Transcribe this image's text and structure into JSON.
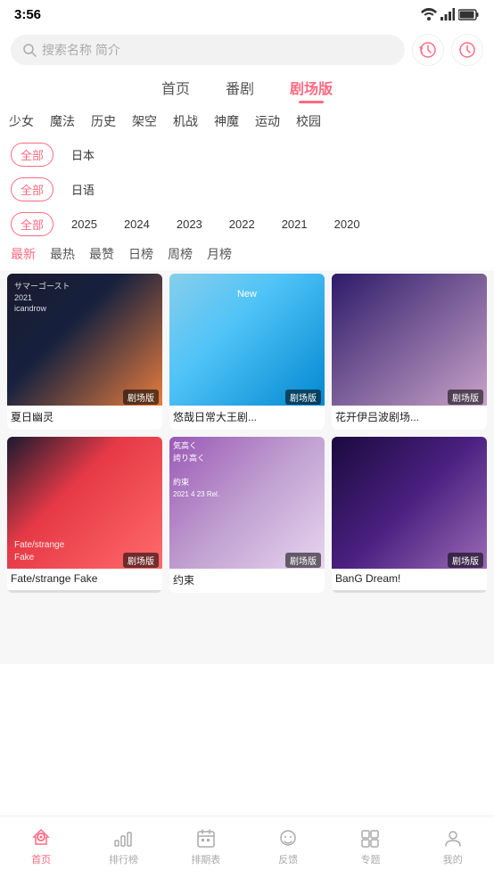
{
  "status": {
    "time": "3:56",
    "battery_icon": "🔋",
    "signal_icon": "📶"
  },
  "search": {
    "placeholder": "搜索名称 简介",
    "history_icon": "history",
    "clock_icon": "clock"
  },
  "nav": {
    "tabs": [
      {
        "id": "home",
        "label": "首页",
        "active": false
      },
      {
        "id": "series",
        "label": "番剧",
        "active": false
      },
      {
        "id": "theater",
        "label": "剧场版",
        "active": true
      }
    ]
  },
  "genres": [
    "女",
    "魔法",
    "历史",
    "架空",
    "机战",
    "神魔",
    "运动",
    "校"
  ],
  "filters": {
    "region": {
      "options": [
        "全部",
        "日本"
      ],
      "active": "全部"
    },
    "language": {
      "options": [
        "全部",
        "日语"
      ],
      "active": "全部"
    },
    "year": {
      "options": [
        "全部",
        "2025",
        "2024",
        "2023",
        "2022",
        "2021",
        "2020"
      ],
      "active": "全部"
    }
  },
  "sort": {
    "options": [
      "最新",
      "最热",
      "最赞",
      "日榜",
      "周榜",
      "月榜"
    ],
    "active": "最新"
  },
  "anime_list": [
    {
      "id": 1,
      "title": "夏日幽灵",
      "badge": "剧场版",
      "thumb_class": "thumb-1",
      "overlay": "サマーゴースト\n2021\nicandrow"
    },
    {
      "id": 2,
      "title": "悠哉日常大王剧...",
      "badge": "剧场版",
      "thumb_class": "thumb-2",
      "overlay": ""
    },
    {
      "id": 3,
      "title": "花开伊吕波剧场...",
      "badge": "剧场版",
      "thumb_class": "thumb-3",
      "overlay": ""
    },
    {
      "id": 4,
      "title": "Fate/strange Fake",
      "badge": "剧场版",
      "thumb_class": "thumb-4",
      "overlay": "Fate/strange\nFake"
    },
    {
      "id": 5,
      "title": "约束",
      "badge": "剧场版",
      "thumb_class": "thumb-5",
      "overlay": "気高く\n誇り高く\n\n約束\n2021 4 23 Rel."
    },
    {
      "id": 6,
      "title": "BanG Dream!",
      "badge": "剧场版",
      "thumb_class": "thumb-6",
      "overlay": ""
    }
  ],
  "bottom_nav": [
    {
      "id": "home",
      "label": "首页",
      "icon": "🏠",
      "active": true
    },
    {
      "id": "ranking",
      "label": "排行榜",
      "icon": "📊",
      "active": false
    },
    {
      "id": "schedule",
      "label": "排期表",
      "icon": "📅",
      "active": false
    },
    {
      "id": "feedback",
      "label": "反馈",
      "icon": "💬",
      "active": false
    },
    {
      "id": "topic",
      "label": "专题",
      "icon": "🎯",
      "active": false
    },
    {
      "id": "mine",
      "label": "我的",
      "icon": "👤",
      "active": false
    }
  ]
}
